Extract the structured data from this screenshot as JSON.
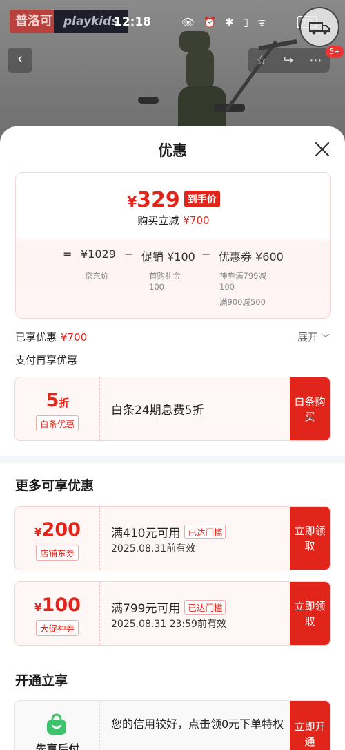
{
  "status": {
    "brand_cn": "普洛可",
    "brand_en": "playkids",
    "time": "12:18",
    "icons": "👁 ⏰ ✱ ▯ ᯤ",
    "battery": "70",
    "badge": "5+"
  },
  "sheet": {
    "title": "优惠",
    "price_card": {
      "currency": "¥",
      "final_price": "329",
      "final_tag": "到手价",
      "save_label": "购买立减",
      "save_amount": "¥700",
      "equals": "=",
      "minus": "−",
      "jd_price": "¥1029",
      "jd_price_label": "京东价",
      "promo": "促销 ¥100",
      "promo_detail_1": "首购礼金",
      "promo_detail_2": "100",
      "coupon": "优惠券 ¥600",
      "coupon_detail_1": "神券满799减",
      "coupon_detail_2": "100",
      "coupon_detail_3": "满900减500"
    },
    "enjoyed_label": "已享优惠",
    "enjoyed_amount": "¥700",
    "expand_label": "展开",
    "pay_more_label": "支付再享优惠",
    "baitiao": {
      "amount": "5",
      "unit": "折",
      "pill": "白条优惠",
      "desc": "白条24期息费5折",
      "action": "白条购买"
    },
    "more_title": "更多可享优惠",
    "coupons": [
      {
        "currency": "¥",
        "amount": "200",
        "pill": "店铺东券",
        "condition": "满410元可用",
        "tag": "已达门槛",
        "expiry": "2025.08.31前有效",
        "action": "立即领取"
      },
      {
        "currency": "¥",
        "amount": "100",
        "pill": "大促神券",
        "condition": "满799元可用",
        "tag": "已达门槛",
        "expiry": "2025.08.31 23:59前有效",
        "action": "立即领取"
      }
    ],
    "open_title": "开通立享",
    "credit": {
      "name": "先享后付",
      "text": "您的信用较好，点击领0元下单特权",
      "action": "立即开通"
    }
  },
  "colors": {
    "accent": "#e1251b",
    "overlay": "#7b7b7b"
  }
}
